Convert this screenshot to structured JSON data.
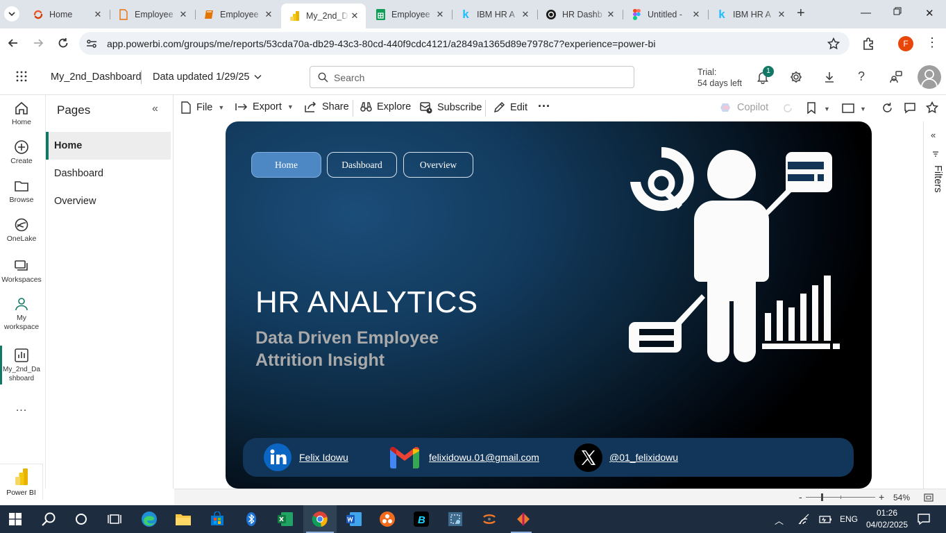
{
  "browser": {
    "tabs": [
      {
        "title": "Home",
        "icon": "microsoft-365-icon"
      },
      {
        "title": "Employee",
        "icon": "document-icon"
      },
      {
        "title": "Employee",
        "icon": "book-icon"
      },
      {
        "title": "My_2nd_D",
        "icon": "power-bi-icon",
        "active": true
      },
      {
        "title": "Employee",
        "icon": "google-sheets-icon"
      },
      {
        "title": "IBM HR A",
        "icon": "kaggle-icon"
      },
      {
        "title": "HR Dashb",
        "icon": "chatgpt-icon"
      },
      {
        "title": "Untitled -",
        "icon": "figma-icon"
      },
      {
        "title": "IBM HR A",
        "icon": "kaggle-icon"
      }
    ],
    "url": "app.powerbi.com/groups/me/reports/53cda70a-db29-43c3-80cd-440f9cdc4121/a2849a1365d89e7978c7?experience=power-bi",
    "profile_initial": "F"
  },
  "pbi_header": {
    "report_name": "My_2nd_Dashboard",
    "data_updated": "Data updated 1/29/25",
    "search_placeholder": "Search",
    "trial_line1": "Trial:",
    "trial_line2": "54 days left",
    "notification_count": "1"
  },
  "rail": {
    "items": [
      {
        "label": "Home",
        "icon": "home-icon"
      },
      {
        "label": "Create",
        "icon": "plus-circle-icon"
      },
      {
        "label": "Browse",
        "icon": "folder-icon"
      },
      {
        "label": "OneLake",
        "icon": "onelake-icon"
      },
      {
        "label": "Workspaces",
        "icon": "workspaces-icon"
      },
      {
        "label": "My workspace",
        "icon": "person-icon"
      },
      {
        "label": "My_2nd_Dashboard",
        "icon": "report-icon",
        "active": true
      }
    ],
    "more": "...",
    "app_label": "Power BI"
  },
  "pages_panel": {
    "title": "Pages",
    "pages": [
      "Home",
      "Dashboard",
      "Overview"
    ],
    "active_page": "Home"
  },
  "toolbar": {
    "file": "File",
    "export": "Export",
    "share": "Share",
    "explore": "Explore",
    "subscribe": "Subscribe",
    "edit": "Edit",
    "more": "···",
    "copilot": "Copilot"
  },
  "report": {
    "nav_buttons": [
      "Home",
      "Dashboard",
      "Overview"
    ],
    "active_nav": "Home",
    "title": "HR ANALYTICS",
    "subtitle": "Data Driven Employee Attrition Insight",
    "contacts": [
      {
        "icon": "linkedin-icon",
        "text": "Felix Idowu"
      },
      {
        "icon": "gmail-icon",
        "text": "felixidowu.01@gmail.com"
      },
      {
        "icon": "x-twitter-icon",
        "text": "@01_felixidowu"
      }
    ],
    "colors": {
      "nav_active": "#4d88c4",
      "contact_bar": "#12365a",
      "linkedin": "#0a66c2"
    }
  },
  "filters_label": "Filters",
  "zoom": {
    "level": "54%",
    "minus": "-",
    "plus": "+"
  },
  "taskbar": {
    "language": "ENG",
    "time": "01:26",
    "date": "04/02/2025"
  }
}
